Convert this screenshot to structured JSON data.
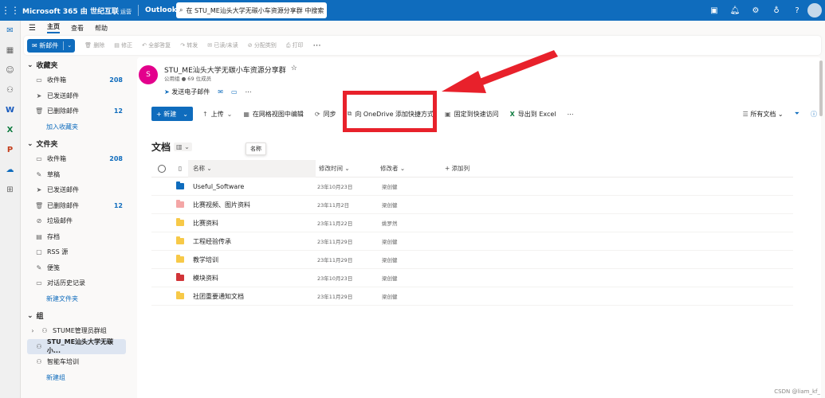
{
  "topbar": {
    "brand": "Microsoft 365 由",
    "brand_partner": "世纪互联",
    "brand_suffix": "运营",
    "app": "Outlook",
    "search_placeholder": "在 STU_ME汕头大学无碳小车资源分享群 中搜索"
  },
  "ribbon_tabs": [
    "主页",
    "查看",
    "帮助"
  ],
  "ribbon": {
    "new_mail": "新邮件",
    "delete": "删除",
    "archive": "修正",
    "reply_all": "全部答复",
    "forward": "转发",
    "read_unread": "已读/未读",
    "categorize": "分配类别",
    "print": "打印",
    "more": "⋯"
  },
  "sidebar": {
    "favorites_title": "收藏夹",
    "favorites": [
      {
        "label": "收件箱",
        "count": "208",
        "icon": "inbox-icon"
      },
      {
        "label": "已发送邮件",
        "count": "",
        "icon": "send-icon"
      },
      {
        "label": "已删除邮件",
        "count": "12",
        "icon": "trash-icon"
      }
    ],
    "add_favorite": "加入收藏夹",
    "folders_title": "文件夹",
    "folders": [
      {
        "label": "收件箱",
        "count": "208",
        "icon": "inbox-icon"
      },
      {
        "label": "草稿",
        "count": "",
        "icon": "pencil-icon"
      },
      {
        "label": "已发送邮件",
        "count": "",
        "icon": "send-icon"
      },
      {
        "label": "已删除邮件",
        "count": "12",
        "icon": "trash-icon"
      },
      {
        "label": "垃圾邮件",
        "count": "",
        "icon": "junk-icon"
      },
      {
        "label": "存档",
        "count": "",
        "icon": "archive-icon"
      },
      {
        "label": "RSS 源",
        "count": "",
        "icon": "rss-icon"
      },
      {
        "label": "便笺",
        "count": "",
        "icon": "note-icon"
      },
      {
        "label": "对话历史记录",
        "count": "",
        "icon": "folder-icon"
      }
    ],
    "new_folder": "新建文件夹",
    "groups_title": "组",
    "groups": [
      {
        "label": "STUME管理员群组",
        "selected": false
      },
      {
        "label": "STU_ME汕头大学无碳小...",
        "selected": true
      },
      {
        "label": "智能车培训",
        "selected": false
      }
    ],
    "new_group": "新建组"
  },
  "group": {
    "avatar": "S",
    "name": "STU_ME汕头大学无碳小车资源分享群",
    "meta": "公用组  ●  69 位成员",
    "send_email": "发送电子邮件"
  },
  "doc_toolbar": {
    "new": "新建",
    "upload": "上传",
    "grid_edit": "在网格视图中编辑",
    "sync": "同步",
    "add_shortcut": "向 OneDrive 添加快捷方式",
    "pin": "固定到快速访问",
    "export": "导出到 Excel",
    "more": "⋯",
    "all_docs": "所有文档"
  },
  "documents": {
    "title": "文档",
    "tooltip": "名称",
    "columns": {
      "name": "名称",
      "modified": "修改时间",
      "modified_by": "修改者",
      "add_column": "+ 添加列"
    },
    "rows": [
      {
        "name": "Useful_Software",
        "modified": "23年10月23日",
        "by": "梁创健",
        "color": "#0f6cbd"
      },
      {
        "name": "比赛视频、图片资料",
        "modified": "23年11月2日",
        "by": "梁创健",
        "color": "#f4a6a6"
      },
      {
        "name": "比赛资料",
        "modified": "23年11月22日",
        "by": "姚罗然",
        "color": "#f7c948"
      },
      {
        "name": "工程经验传承",
        "modified": "23年11月29日",
        "by": "梁创健",
        "color": "#f7c948"
      },
      {
        "name": "教学培训",
        "modified": "23年11月29日",
        "by": "梁创健",
        "color": "#f7c948"
      },
      {
        "name": "模块资料",
        "modified": "23年10月23日",
        "by": "梁创健",
        "color": "#d13438"
      },
      {
        "name": "社团重要通知文档",
        "modified": "23年11月29日",
        "by": "梁创健",
        "color": "#f7c948"
      }
    ]
  },
  "watermark": "CSDN @liam_kf_"
}
